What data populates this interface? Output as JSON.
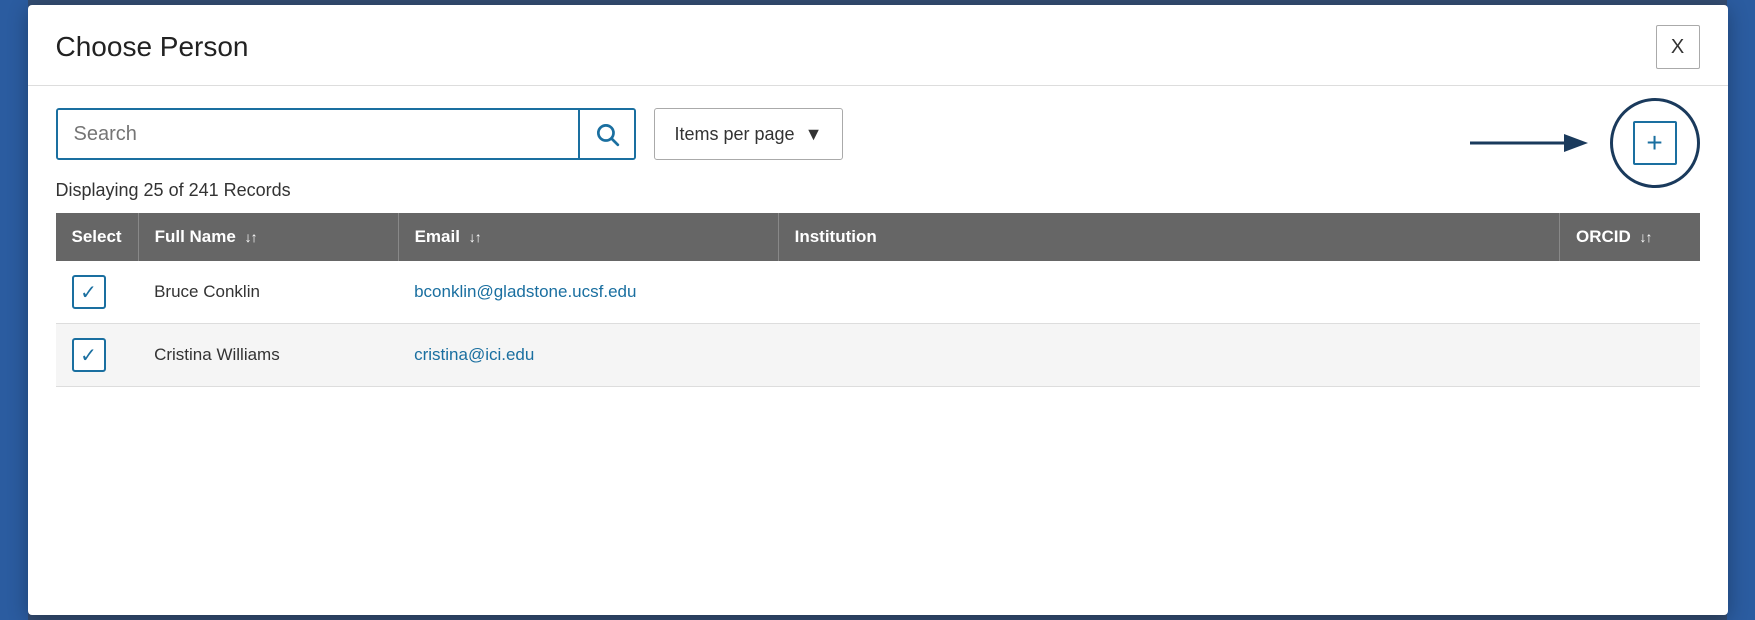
{
  "modal": {
    "title": "Choose Person",
    "close_label": "X"
  },
  "search": {
    "placeholder": "Search",
    "button_label": "Search"
  },
  "items_per_page": {
    "label": "Items per page"
  },
  "add_person": {
    "plus_label": "+"
  },
  "display_info": {
    "text": "Displaying 25 of 241 Records"
  },
  "table": {
    "columns": [
      {
        "label": "Select",
        "sort": false
      },
      {
        "label": "Full Name",
        "sort": true
      },
      {
        "label": "Email",
        "sort": true
      },
      {
        "label": "Institution",
        "sort": false
      },
      {
        "label": "ORCID",
        "sort": true
      }
    ],
    "rows": [
      {
        "select": true,
        "full_name": "Bruce Conklin",
        "email": "bconklin@gladstone.ucsf.edu",
        "institution": "",
        "orcid": ""
      },
      {
        "select": true,
        "full_name": "Cristina Williams",
        "email": "cristina@ici.edu",
        "institution": "",
        "orcid": ""
      }
    ]
  },
  "colors": {
    "primary_blue": "#1a6fa0",
    "dark_navy": "#1a3a5c",
    "header_gray": "#666666"
  }
}
